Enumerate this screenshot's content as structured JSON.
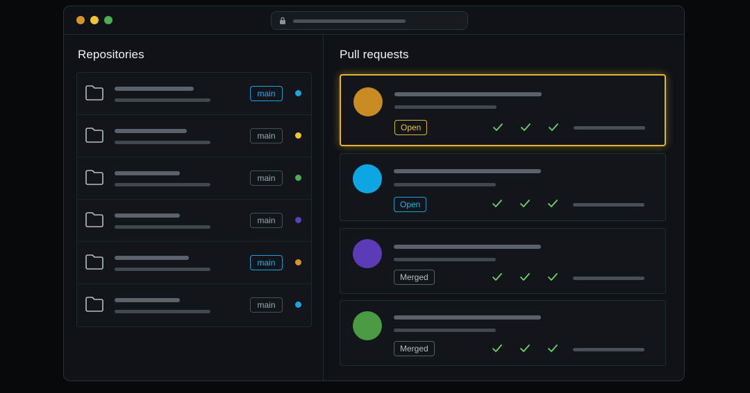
{
  "repositories": {
    "title": "Repositories",
    "items": [
      {
        "branch": "main",
        "branch_active": true,
        "dot_color": "#1ea3df"
      },
      {
        "branch": "main",
        "branch_active": false,
        "dot_color": "#f1c232"
      },
      {
        "branch": "main",
        "branch_active": false,
        "dot_color": "#4dad55"
      },
      {
        "branch": "main",
        "branch_active": false,
        "dot_color": "#5c3fc1"
      },
      {
        "branch": "main",
        "branch_active": true,
        "dot_color": "#d8922a"
      },
      {
        "branch": "main",
        "branch_active": false,
        "dot_color": "#1ea3df"
      }
    ]
  },
  "pull_requests": {
    "title": "Pull requests",
    "items": [
      {
        "status": "Open",
        "avatar_color": "#c98a24",
        "selected": true
      },
      {
        "status": "Open",
        "avatar_color": "#0ea5e4",
        "selected": false
      },
      {
        "status": "Merged",
        "avatar_color": "#5b3bb8",
        "selected": false
      },
      {
        "status": "Merged",
        "avatar_color": "#4a9a44",
        "selected": false
      }
    ]
  },
  "colors": {
    "accent_yellow": "#e8b53a",
    "accent_blue": "#1ea3df",
    "check_green": "#6fd26a"
  },
  "icons": [
    "lock-icon",
    "folder-icon",
    "check-icon"
  ]
}
